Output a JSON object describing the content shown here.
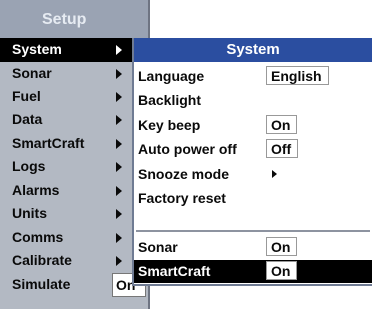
{
  "setup_menu": {
    "title": "Setup",
    "items": [
      {
        "label": "System",
        "has_submenu": true,
        "selected": true
      },
      {
        "label": "Sonar",
        "has_submenu": true
      },
      {
        "label": "Fuel",
        "has_submenu": true
      },
      {
        "label": "Data",
        "has_submenu": true
      },
      {
        "label": "SmartCraft",
        "has_submenu": true
      },
      {
        "label": "Logs",
        "has_submenu": true
      },
      {
        "label": "Alarms",
        "has_submenu": true
      },
      {
        "label": "Units",
        "has_submenu": true
      },
      {
        "label": "Comms",
        "has_submenu": true
      },
      {
        "label": "Calibrate",
        "has_submenu": true
      },
      {
        "label": "Simulate",
        "value": "On"
      }
    ]
  },
  "system_menu": {
    "title": "System",
    "items": [
      {
        "label": "Language",
        "value": "English"
      },
      {
        "label": "Backlight"
      },
      {
        "label": "Key beep",
        "value": "On"
      },
      {
        "label": "Auto power off",
        "value": "Off"
      },
      {
        "label": "Snooze mode",
        "has_submenu": true
      },
      {
        "label": "Factory reset"
      },
      {
        "label": "Sonar",
        "value": "On"
      },
      {
        "label": "SmartCraft",
        "value": "On",
        "selected": true
      }
    ]
  },
  "colors": {
    "header_blue": "#2b4ea0",
    "menu_gray": "#b3b9c3",
    "title_gray": "#9aa3b3",
    "selection": "#000000"
  }
}
